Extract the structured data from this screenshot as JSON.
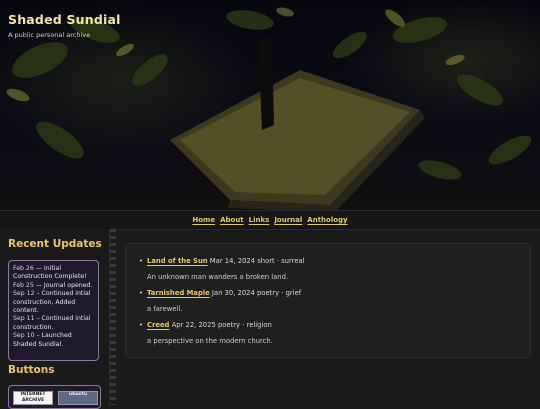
{
  "site": {
    "title": "Shaded Sundial",
    "subtitle": "A public personal archive"
  },
  "nav": {
    "items": [
      "Home",
      "About",
      "Links",
      "Journal",
      "Anthology"
    ]
  },
  "sidebar": {
    "recent_heading": "Recent Updates",
    "updates": [
      {
        "date": "Feb 26",
        "text": " — Initial Construction Complete!"
      },
      {
        "date": "Feb 25",
        "text": " — Journal opened."
      },
      {
        "date": "Sep 12",
        "text": " – Continued intial construction, Added content."
      },
      {
        "date": "Sep 11",
        "text": " – Continued intial construction."
      },
      {
        "date": "Sep 10",
        "text": " – Launched Shaded Sundial."
      }
    ],
    "buttons_heading": "Buttons",
    "badges": [
      "INTERNET ARCHIVE",
      "ubuntu"
    ]
  },
  "posts": [
    {
      "title": "Land of the Sun",
      "meta": " Mar 14, 2024 short · surreal",
      "description": "An unknown man wanders a broken land."
    },
    {
      "title": "Tarnished Maple",
      "meta": " Jan 30, 2024 poetry · grief",
      "description": "a farewell."
    },
    {
      "title": "Creed",
      "meta": " Apr 22, 2025 poetry · religion",
      "description": "a perspective on the modern church."
    }
  ],
  "colors": {
    "accent": "#e7c766",
    "title": "#f2e6a8",
    "background": "#1b1b1b",
    "sidebar_box": "#201b2c",
    "sidebar_box_border": "#8c7a9e"
  }
}
